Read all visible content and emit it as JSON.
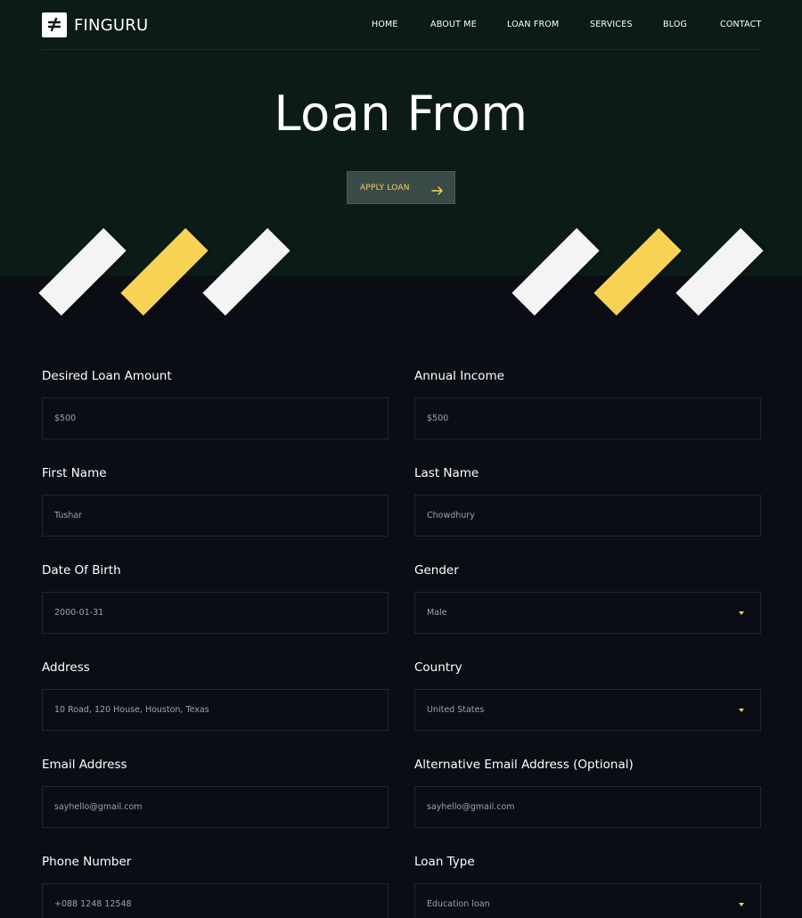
{
  "brand": {
    "name": "FINGURU"
  },
  "nav": {
    "items": [
      "HOME",
      "ABOUT ME",
      "LOAN FROM",
      "SERVICES",
      "BLOG",
      "CONTACT"
    ]
  },
  "hero": {
    "title": "Loan From",
    "apply_button": "APPLY LOAN"
  },
  "colors": {
    "hero_bg": "#0c1b17",
    "page_bg": "#0a0e14",
    "accent_yellow": "#f7d254",
    "button_bg": "#3a4a46"
  },
  "icons": {
    "logo": "logo-mark-icon",
    "apply": "arrow-right-icon",
    "select": "caret-down-icon"
  },
  "form": {
    "fields": [
      {
        "label": "Desired Loan Amount",
        "value": "$500",
        "type": "input"
      },
      {
        "label": "Annual Income",
        "value": "$500",
        "type": "input"
      },
      {
        "label": "First Name",
        "value": "Tushar",
        "type": "input"
      },
      {
        "label": "Last Name",
        "value": "Chowdhury",
        "type": "input"
      },
      {
        "label": "Date Of Birth",
        "value": "2000-01-31",
        "type": "input"
      },
      {
        "label": "Gender",
        "value": "Male",
        "type": "select"
      },
      {
        "label": "Address",
        "value": "10 Road, 120 House, Houston, Texas",
        "type": "input"
      },
      {
        "label": "Country",
        "value": "United States",
        "type": "select"
      },
      {
        "label": "Email Address",
        "value": "sayhello@gmail.com",
        "type": "input"
      },
      {
        "label": "Alternative Email Address (Optional)",
        "value": "sayhello@gmail.com",
        "type": "input"
      },
      {
        "label": "Phone Number",
        "value": "+088 1248 12548",
        "type": "input"
      },
      {
        "label": "Loan Type",
        "value": "Education loan",
        "type": "select"
      }
    ]
  }
}
